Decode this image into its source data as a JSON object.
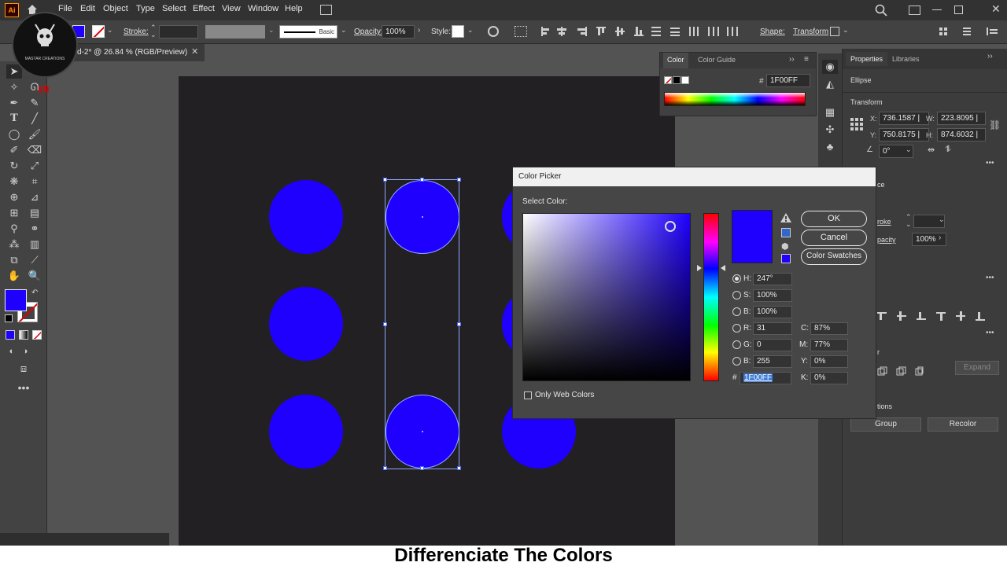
{
  "app": {
    "logo": "Ai",
    "menus": [
      "File",
      "Edit",
      "Object",
      "Type",
      "Select",
      "Effect",
      "View",
      "Window",
      "Help"
    ]
  },
  "control_bar": {
    "stroke_label": "Stroke:",
    "brush_label": "Basic",
    "opacity_label": "Opacity:",
    "opacity_value": "100%",
    "style_label": "Style:",
    "shape_label": "Shape:",
    "transform_label": "Transform"
  },
  "document_tab": {
    "title": "d-2* @ 26.84 % (RGB/Preview)",
    "close": "✕"
  },
  "watermark": {
    "text": "MASTAR CREATIONS",
    "badge": "#9"
  },
  "color_panel": {
    "tabs": [
      "Color",
      "Color Guide"
    ],
    "hash_label": "#",
    "hex_value": "1F00FF"
  },
  "properties_panel": {
    "tabs": [
      "Properties",
      "Libraries"
    ],
    "object_type": "Ellipse",
    "transform_label": "Transform",
    "x_label": "X:",
    "x_value": "736.1587 |",
    "y_label": "Y:",
    "y_value": "750.8175 |",
    "w_label": "W:",
    "w_value": "223.8095 |",
    "h_label": "H:",
    "h_value": "874.6032 |",
    "angle_value": "0°",
    "appearance_partial": "ce",
    "stroke_partial": "roke",
    "opacity_partial": "pacity",
    "opacity_value": "100%",
    "r_partial": "r",
    "expand_label": "Expand",
    "actions_partial": "tions",
    "group_button": "Group",
    "recolor_button": "Recolor"
  },
  "color_picker": {
    "title": "Color Picker",
    "select_label": "Select Color:",
    "ok": "OK",
    "cancel": "Cancel",
    "swatches": "Color Swatches",
    "h_label": "H:",
    "h_value": "247°",
    "s_label": "S:",
    "s_value": "100%",
    "b_label": "B:",
    "b_value": "100%",
    "r_label": "R:",
    "r_value": "31",
    "g_label": "G:",
    "g_value": "0",
    "blue_label": "B:",
    "blue_value": "255",
    "c_label": "C:",
    "c_value": "87%",
    "m_label": "M:",
    "m_value": "77%",
    "yl_label": "Y:",
    "yl_value": "0%",
    "k_label": "K:",
    "k_value": "0%",
    "hex_label": "#",
    "hex_value": "1F00FF",
    "web_colors": "Only Web Colors"
  },
  "colors": {
    "selected": "#1f00ff",
    "artboard": "#222022"
  },
  "caption": "Differenciate The Colors"
}
